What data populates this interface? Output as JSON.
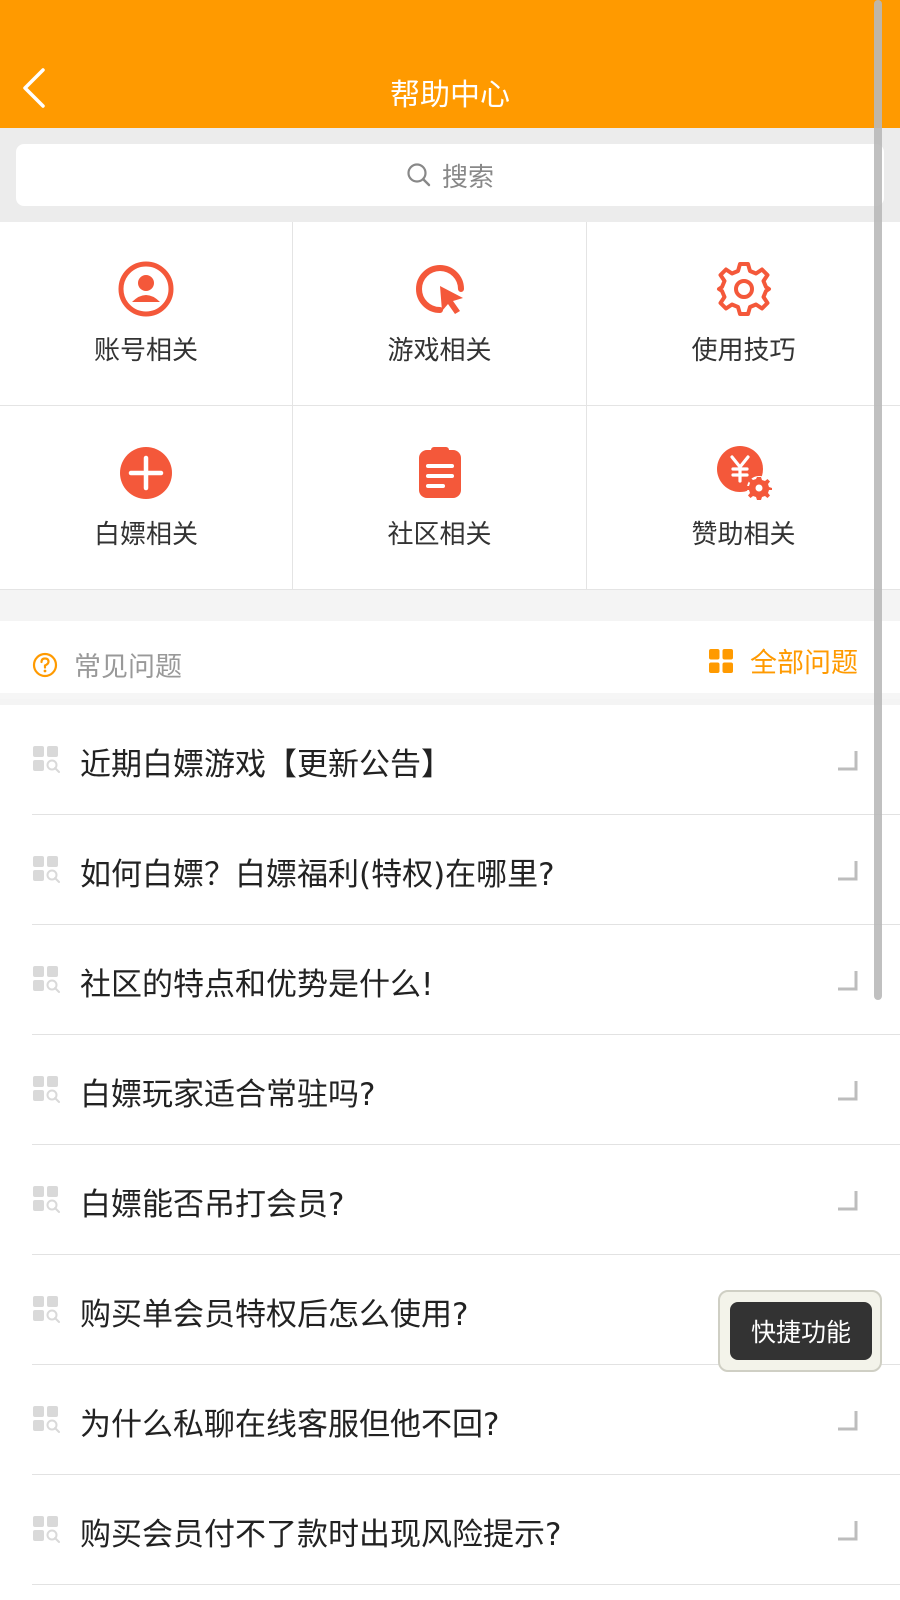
{
  "header": {
    "title": "帮助中心",
    "back_icon": "chevron-left-icon"
  },
  "search": {
    "label": "搜索",
    "icon": "search-icon"
  },
  "categories": [
    {
      "label": "账号相关",
      "icon": "user-circle-icon"
    },
    {
      "label": "游戏相关",
      "icon": "cursor-click-icon"
    },
    {
      "label": "使用技巧",
      "icon": "gear-icon"
    },
    {
      "label": "白嫖相关",
      "icon": "plus-circle-icon"
    },
    {
      "label": "社区相关",
      "icon": "clipboard-icon"
    },
    {
      "label": "赞助相关",
      "icon": "yuan-gear-icon"
    }
  ],
  "faq": {
    "title": "常见问题",
    "all_label": "全部问题",
    "items": [
      "近期白嫖游戏【更新公告】",
      "如何白嫖？白嫖福利(特权)在哪里?",
      "社区的特点和优势是什么!",
      "白嫖玩家适合常驻吗?",
      "白嫖能否吊打会员?",
      "购买单会员特权后怎么使用?",
      "为什么私聊在线客服但他不回?",
      "购买会员付不了款时出现风险提示?"
    ]
  },
  "quick": {
    "label": "快捷功能"
  },
  "colors": {
    "brand": "#ff9a00",
    "icon_red": "#f4583a"
  }
}
